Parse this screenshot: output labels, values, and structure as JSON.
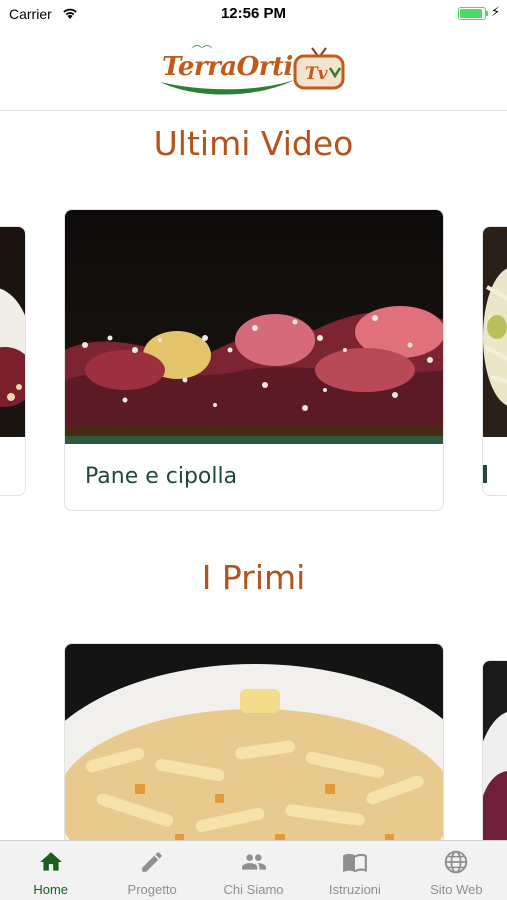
{
  "status_bar": {
    "carrier": "Carrier",
    "time": "12:56 PM"
  },
  "header": {
    "logo_text": "TerraOrti",
    "logo_tv_text": "Tv"
  },
  "sections": [
    {
      "title": "Ultimi Video",
      "cards": [
        {
          "caption": "Pane e cipolla"
        }
      ]
    },
    {
      "title": "I Primi"
    }
  ],
  "tab_bar": {
    "active_tab": "Home",
    "tabs": [
      {
        "label": "Home",
        "icon": "home-icon"
      },
      {
        "label": "Progetto",
        "icon": "pencil-icon"
      },
      {
        "label": "Chi Siamo",
        "icon": "people-icon"
      },
      {
        "label": "Istruzioni",
        "icon": "book-icon"
      },
      {
        "label": "Sito Web",
        "icon": "globe-icon"
      }
    ]
  },
  "colors": {
    "brand_orange": "#b4531b",
    "brand_green": "#1b5e20",
    "caption_green": "#1f4a36"
  }
}
